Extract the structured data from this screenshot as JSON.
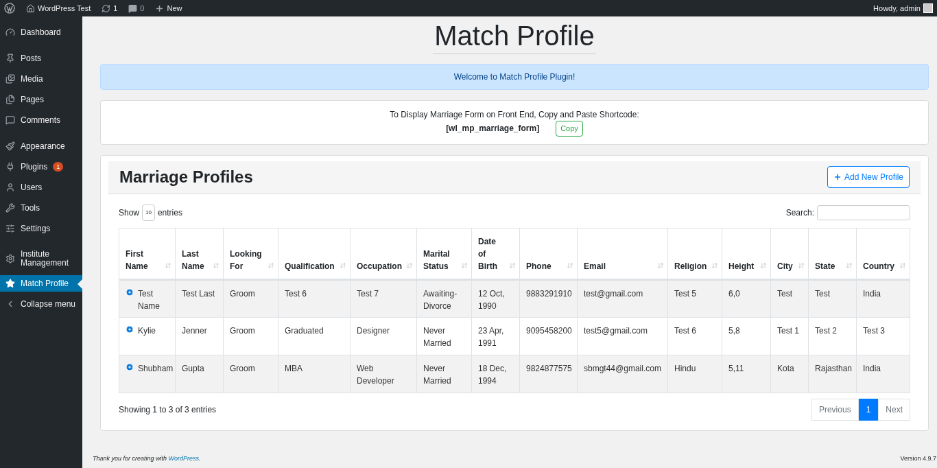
{
  "admin_bar": {
    "site": "WordPress Test",
    "updates": "1",
    "comments": "0",
    "new": "New",
    "greeting": "Howdy, admin"
  },
  "sidebar": {
    "items": [
      {
        "label": "Dashboard",
        "selected": false
      },
      {
        "label": "Posts",
        "selected": false
      },
      {
        "label": "Media",
        "selected": false
      },
      {
        "label": "Pages",
        "selected": false
      },
      {
        "label": "Comments",
        "selected": false
      },
      {
        "label": "Appearance",
        "selected": false
      },
      {
        "label": "Plugins",
        "selected": false,
        "badge": "1"
      },
      {
        "label": "Users",
        "selected": false
      },
      {
        "label": "Tools",
        "selected": false
      },
      {
        "label": "Settings",
        "selected": false
      },
      {
        "label": "Institute Management",
        "selected": false
      },
      {
        "label": "Match Profile",
        "selected": true
      },
      {
        "label": "Collapse menu",
        "selected": false
      }
    ]
  },
  "page_title": "Match Profile",
  "welcome": "Welcome to Match Profile Plugin!",
  "shortcode_box": {
    "text": "To Display Marriage Form on Front End, Copy and Paste Shortcode:",
    "shortcode": "[wl_mp_marriage_form]",
    "copy": "Copy"
  },
  "profiles": {
    "title": "Marriage Profiles",
    "add_button": "Add New Profile",
    "show": "Show",
    "page_size": "10",
    "entries": "entries",
    "search_label": "Search:",
    "columns": [
      "First Name",
      "Last Name",
      "Looking For",
      "Qualification",
      "Occupation",
      "Marital Status",
      "Date of Birth",
      "Phone",
      "Email",
      "Religion",
      "Height",
      "City",
      "State",
      "Country"
    ],
    "rows": [
      [
        "Test Name",
        "Test Last",
        "Groom",
        "Test 6",
        "Test 7",
        "Awaiting-Divorce",
        "12 Oct, 1990",
        "9883291910",
        "test@gmail.com",
        "Test 5",
        "6,0",
        "Test",
        "Test",
        "India"
      ],
      [
        "Kylie",
        "Jenner",
        "Groom",
        "Graduated",
        "Designer",
        "Never Married",
        "23 Apr, 1991",
        "9095458200",
        "test5@gmail.com",
        "Test 6",
        "5,8",
        "Test 1",
        "Test 2",
        "Test 3"
      ],
      [
        "Shubham",
        "Gupta",
        "Groom",
        "MBA",
        "Web Developer",
        "Never Married",
        "18 Dec, 1994",
        "9824877575",
        "sbmgt44@gmail.com",
        "Hindu",
        "5,11",
        "Kota",
        "Rajasthan",
        "India"
      ]
    ],
    "info": "Showing 1 to 3 of 3 entries",
    "pagination": [
      {
        "label": "Previous",
        "selected": false
      },
      {
        "label": "1",
        "selected": true
      },
      {
        "label": "Next",
        "selected": false
      }
    ]
  },
  "footer": {
    "thanks": "Thank you for creating with",
    "link": "WordPress",
    "end": ".",
    "version": "Version 4.9.7"
  }
}
